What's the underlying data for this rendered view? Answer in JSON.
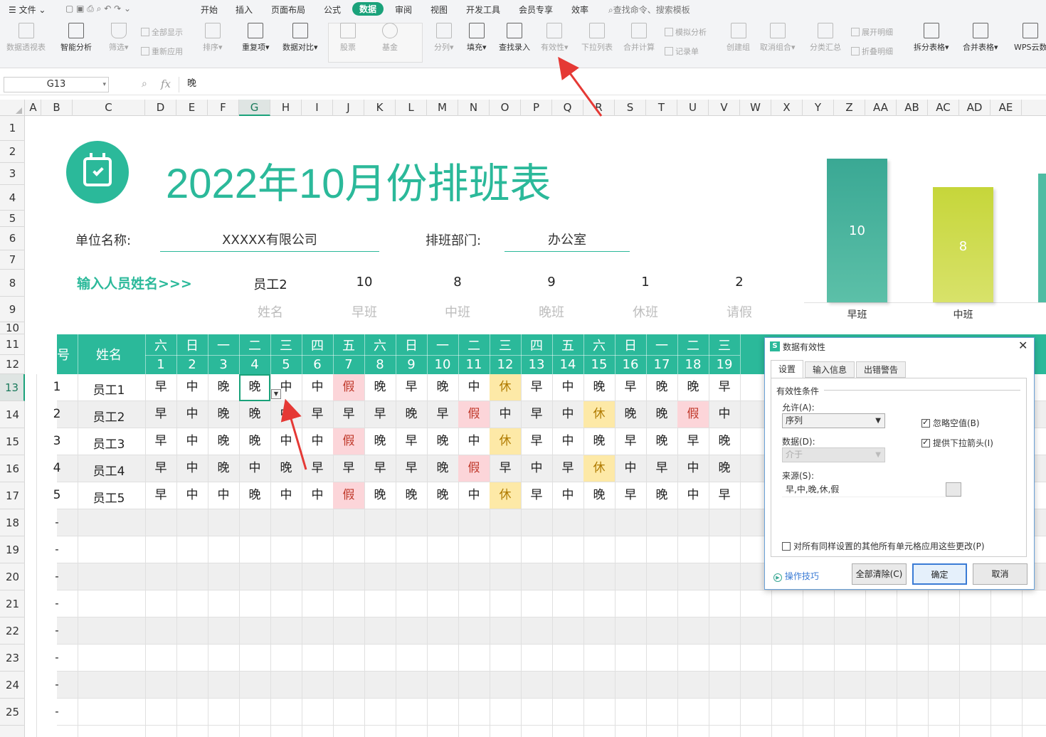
{
  "menubar": {
    "file": "文件",
    "tabs": [
      "开始",
      "插入",
      "页面布局",
      "公式",
      "数据",
      "审阅",
      "视图",
      "开发工具",
      "会员专享",
      "效率"
    ],
    "active_tab": "数据",
    "search_placeholder": "查找命令、搜索模板"
  },
  "ribbon": {
    "pivot": "数据透视表",
    "smart": "智能分析",
    "filter": "筛选",
    "show_all": "全部显示",
    "reapply": "重新应用",
    "sort": "排序",
    "duplicates": "重复项",
    "compare": "数据对比",
    "stock": "股票",
    "fund": "基金",
    "split_col": "分列",
    "fill": "填充",
    "lookup": "查找录入",
    "validity": "有效性",
    "dropdown": "下拉列表",
    "consolidate": "合并计算",
    "whatif": "模拟分析",
    "record": "记录单",
    "group": "创建组",
    "ungroup": "取消组合",
    "subtotal": "分类汇总",
    "expand": "展开明细",
    "collapse": "折叠明细",
    "split_table": "拆分表格",
    "merge_table": "合并表格",
    "cloud": "WPS云数"
  },
  "formula_bar": {
    "cell_ref": "G13",
    "fx": "fx",
    "value": "晚"
  },
  "columns": [
    "A",
    "B",
    "C",
    "D",
    "E",
    "F",
    "G",
    "H",
    "I",
    "J",
    "K",
    "L",
    "M",
    "N",
    "O",
    "P",
    "Q",
    "R",
    "S",
    "T",
    "U",
    "V",
    "W",
    "X",
    "Y",
    "Z",
    "AA",
    "AB",
    "AC",
    "AD",
    "AE"
  ],
  "rows": [
    "1",
    "2",
    "3",
    "4",
    "5",
    "6",
    "7",
    "8",
    "9",
    "10",
    "11",
    "12",
    "13",
    "14",
    "15",
    "16",
    "17",
    "18",
    "19",
    "20",
    "21",
    "22",
    "23",
    "24",
    "25"
  ],
  "sheet": {
    "title": "2022年10月份排班表",
    "unit_label": "单位名称:",
    "unit_value": "XXXXX有限公司",
    "dept_label": "排班部门:",
    "dept_value": "办公室",
    "input_prompt": "输入人员姓名>>>",
    "summary_values": [
      "员工2",
      "10",
      "8",
      "9",
      "1",
      "2"
    ],
    "summary_labels": [
      "姓名",
      "早班",
      "中班",
      "晚班",
      "休班",
      "请假"
    ],
    "table_header": {
      "no": "序号",
      "name": "姓名"
    },
    "weekdays": [
      "六",
      "日",
      "一",
      "二",
      "三",
      "四",
      "五",
      "六",
      "日",
      "一",
      "二",
      "三",
      "四",
      "五",
      "六",
      "日",
      "一",
      "二",
      "三"
    ],
    "dates": [
      "1",
      "2",
      "3",
      "4",
      "5",
      "6",
      "7",
      "8",
      "9",
      "10",
      "11",
      "12",
      "13",
      "14",
      "15",
      "16",
      "17",
      "18",
      "19"
    ],
    "employees": [
      {
        "no": "1",
        "name": "员工1",
        "shifts": [
          "早",
          "中",
          "晚",
          "晚",
          "中",
          "中",
          "假",
          "晚",
          "早",
          "晚",
          "中",
          "休",
          "早",
          "中",
          "晚",
          "早",
          "晚",
          "晚",
          "早"
        ]
      },
      {
        "no": "2",
        "name": "员工2",
        "shifts": [
          "早",
          "中",
          "晚",
          "晚",
          "中",
          "早",
          "早",
          "早",
          "晚",
          "早",
          "假",
          "中",
          "早",
          "中",
          "休",
          "晚",
          "晚",
          "假",
          "中"
        ]
      },
      {
        "no": "3",
        "name": "员工3",
        "shifts": [
          "早",
          "中",
          "晚",
          "晚",
          "中",
          "中",
          "假",
          "晚",
          "早",
          "晚",
          "中",
          "休",
          "早",
          "中",
          "晚",
          "早",
          "晚",
          "早",
          "晚"
        ]
      },
      {
        "no": "4",
        "name": "员工4",
        "shifts": [
          "早",
          "中",
          "晚",
          "中",
          "晚",
          "早",
          "早",
          "早",
          "早",
          "晚",
          "假",
          "早",
          "中",
          "早",
          "休",
          "中",
          "早",
          "中",
          "晚"
        ]
      },
      {
        "no": "5",
        "name": "员工5",
        "shifts": [
          "早",
          "中",
          "中",
          "晚",
          "中",
          "中",
          "假",
          "晚",
          "晚",
          "晚",
          "中",
          "休",
          "早",
          "中",
          "晚",
          "早",
          "晚",
          "中",
          "早"
        ]
      }
    ],
    "empty_row_marker": "-"
  },
  "chart_data": {
    "type": "bar",
    "categories": [
      "早班",
      "中班"
    ],
    "values": [
      10,
      8
    ],
    "colors": [
      "#3aa894",
      "#c6d63a"
    ]
  },
  "dialog": {
    "title": "数据有效性",
    "tabs": [
      "设置",
      "输入信息",
      "出错警告"
    ],
    "section": "有效性条件",
    "allow_label": "允许(A):",
    "allow_value": "序列",
    "data_label": "数据(D):",
    "data_value": "介于",
    "ignore_blank": "忽略空值(B)",
    "dropdown_arrow": "提供下拉箭头(I)",
    "source_label": "来源(S):",
    "source_value": "早,中,晚,休,假",
    "apply_all": "对所有同样设置的其他所有单元格应用这些更改(P)",
    "tips": "操作技巧",
    "clear_all": "全部清除(C)",
    "ok": "确定",
    "cancel": "取消"
  },
  "colors": {
    "accent": "#2bb99a",
    "leave_bg": "#fcd5d9",
    "leave_fg": "#c0392b",
    "rest_bg": "#fde9a7",
    "rest_fg": "#b07b00"
  }
}
